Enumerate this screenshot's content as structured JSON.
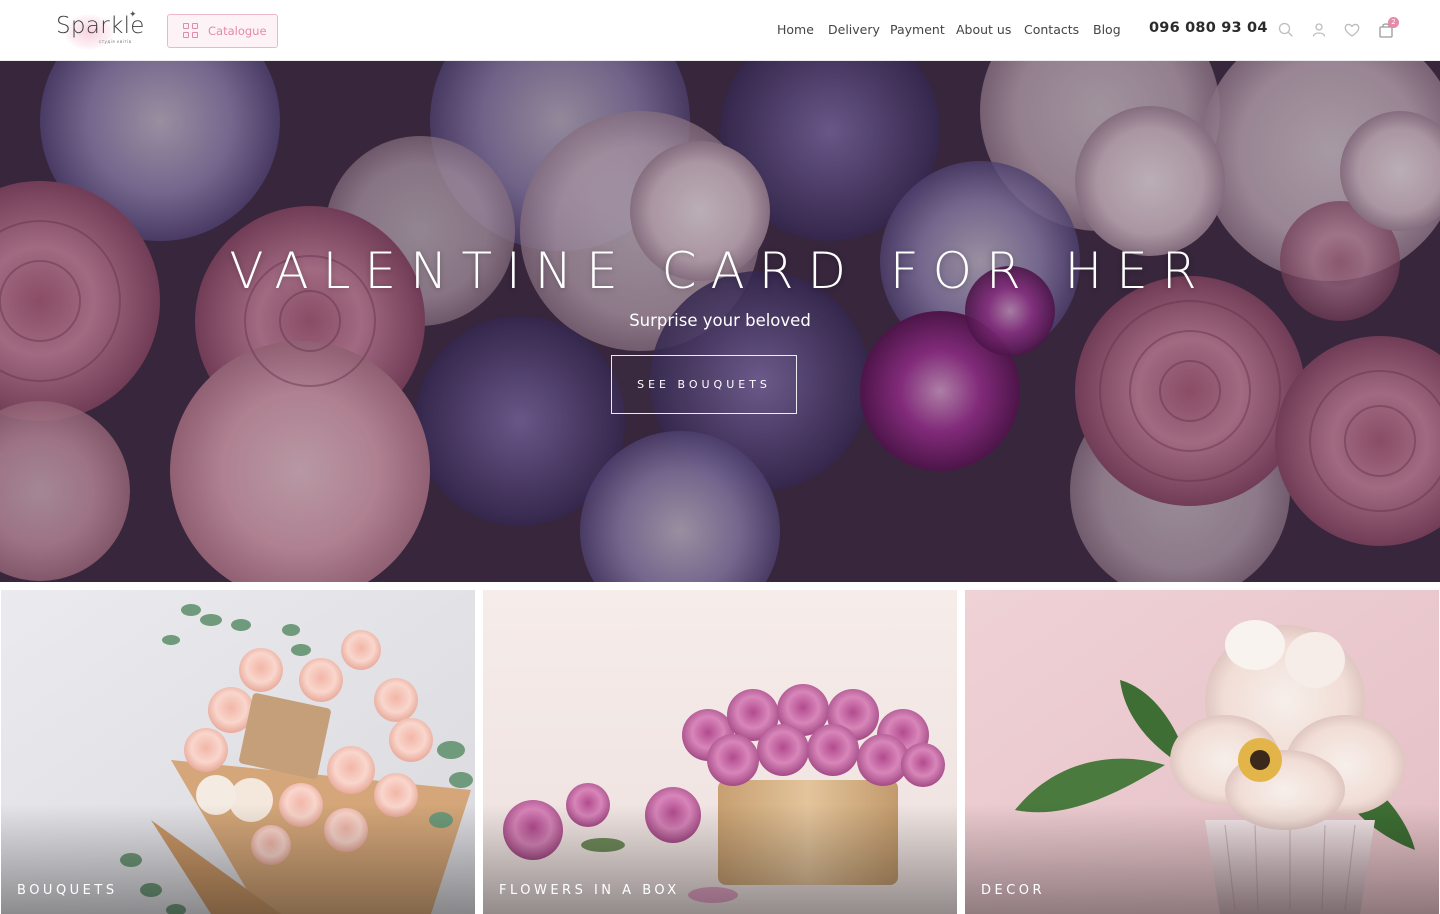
{
  "header": {
    "logo_text": "Sparkle",
    "logo_subtext": "студія квітів",
    "catalogue_label": "Catalogue",
    "nav": [
      "Home",
      "Delivery",
      "Payment",
      "About us",
      "Contacts",
      "Blog"
    ],
    "phone": "096 080 93 04",
    "cart_count": "2",
    "icons": [
      "search-icon",
      "user-icon",
      "heart-icon",
      "shopping-bag-icon"
    ]
  },
  "hero": {
    "title": "VALENTINE CARD FOR HER",
    "subtitle": "Surprise your beloved",
    "button_label": "SEE BOUQUETS"
  },
  "categories": [
    {
      "label": "BOUQUETS"
    },
    {
      "label": "FLOWERS IN A BOX"
    },
    {
      "label": "DECOR"
    }
  ],
  "colors": {
    "accent_pink": "#e58aa8",
    "catalogue_border": "#eeb7c8",
    "text_dark": "#2b2b2b"
  }
}
